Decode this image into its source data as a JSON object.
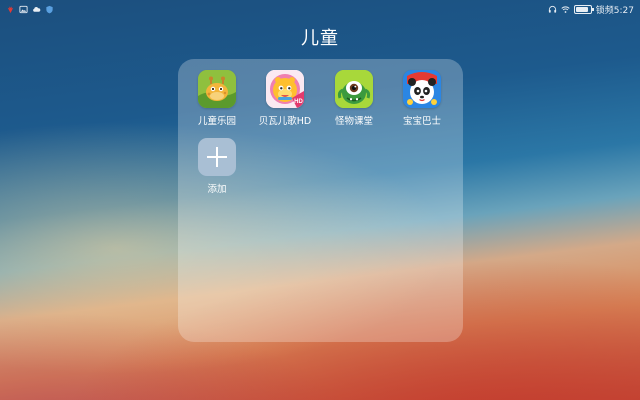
{
  "status_bar": {
    "left_icons": [
      "huawei-logo-icon",
      "gallery-notification-icon",
      "cloud-icon",
      "shield-icon"
    ],
    "right_icons": [
      "headset-icon",
      "wifi-icon",
      "battery-icon"
    ],
    "clock_text": "锁频5:27",
    "battery_level": 0.85
  },
  "folder": {
    "title": "儿童",
    "apps": [
      {
        "label": "儿童乐园",
        "icon": "kids-paradise-giraffe-icon"
      },
      {
        "label": "贝瓦儿歌HD",
        "icon": "beva-songs-hd-icon",
        "badge": "HD"
      },
      {
        "label": "怪物课堂",
        "icon": "monster-class-icon"
      },
      {
        "label": "宝宝巴士",
        "icon": "babybus-panda-icon"
      }
    ],
    "add": {
      "label": "添加",
      "icon": "plus-icon"
    }
  },
  "colors": {
    "folder_bg": "rgba(255,255,255,0.26)",
    "add_tile": "#a9bfd4",
    "text": "#ffffff"
  }
}
